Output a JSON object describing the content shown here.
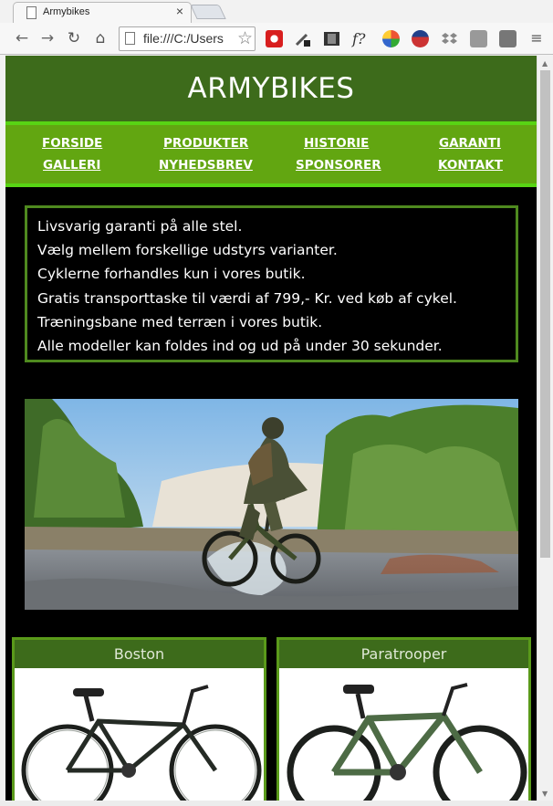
{
  "browser": {
    "tab_title": "Armybikes",
    "tab_close": "×",
    "url": "file:///C:/Users",
    "icons": [
      "back-icon",
      "forward-icon",
      "reload-icon",
      "home-icon",
      "star-icon",
      "menu-icon"
    ]
  },
  "site": {
    "title": "ARMYBIKES",
    "nav": [
      {
        "label": "FORSIDE"
      },
      {
        "label": "PRODUKTER"
      },
      {
        "label": "HISTORIE"
      },
      {
        "label": "GARANTI"
      },
      {
        "label": "GALLERI"
      },
      {
        "label": "NYHEDSBREV"
      },
      {
        "label": "SPONSORER"
      },
      {
        "label": "KONTAKT"
      }
    ],
    "features": [
      "Livsvarig garanti på alle stel.",
      "Vælg mellem forskellige udstyrs varianter.",
      "Cyklerne forhandles kun i vores butik.",
      "Gratis transporttaske til værdi af 799,- Kr. ved køb af cykel.",
      "Træningsbane med terræn i vores butik.",
      "Alle modeller kan foldes ind og ud på under 30 sekunder."
    ],
    "products": [
      {
        "name": "Boston",
        "frame_color": "#1f2a22"
      },
      {
        "name": "Paratrooper",
        "frame_color": "#4d6b45"
      }
    ]
  },
  "colors": {
    "header_green": "#3d6b1b",
    "nav_green": "#62a611",
    "nav_border": "#58d414",
    "box_border": "#4f8a1f"
  }
}
